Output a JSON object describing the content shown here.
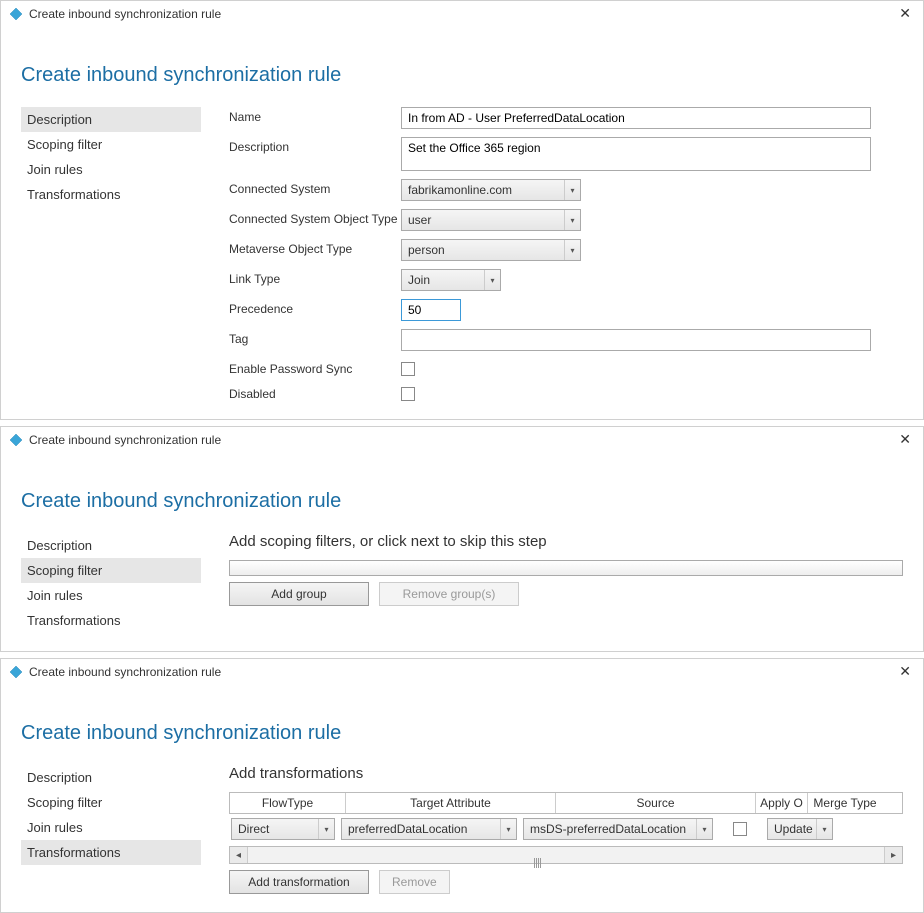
{
  "panel1": {
    "window_title": "Create inbound synchronization rule",
    "page_title": "Create inbound synchronization rule",
    "sidebar": {
      "items": [
        {
          "label": "Description"
        },
        {
          "label": "Scoping filter"
        },
        {
          "label": "Join rules"
        },
        {
          "label": "Transformations"
        }
      ]
    },
    "labels": {
      "name": "Name",
      "description": "Description",
      "connected_system": "Connected System",
      "cs_object_type": "Connected System Object Type",
      "mv_object_type": "Metaverse Object Type",
      "link_type": "Link Type",
      "precedence": "Precedence",
      "tag": "Tag",
      "enable_password_sync": "Enable Password Sync",
      "disabled": "Disabled"
    },
    "values": {
      "name": "In from AD - User PreferredDataLocation",
      "description": "Set the Office 365 region",
      "connected_system": "fabrikamonline.com",
      "cs_object_type": "user",
      "mv_object_type": "person",
      "link_type": "Join",
      "precedence": "50",
      "tag": ""
    }
  },
  "panel2": {
    "window_title": "Create inbound synchronization rule",
    "page_title": "Create inbound synchronization rule",
    "sidebar": {
      "items": [
        {
          "label": "Description"
        },
        {
          "label": "Scoping filter"
        },
        {
          "label": "Join rules"
        },
        {
          "label": "Transformations"
        }
      ]
    },
    "heading": "Add scoping filters, or click next to skip this step",
    "buttons": {
      "add_group": "Add group",
      "remove_groups": "Remove group(s)"
    }
  },
  "panel3": {
    "window_title": "Create inbound synchronization rule",
    "page_title": "Create inbound synchronization rule",
    "sidebar": {
      "items": [
        {
          "label": "Description"
        },
        {
          "label": "Scoping filter"
        },
        {
          "label": "Join rules"
        },
        {
          "label": "Transformations"
        }
      ]
    },
    "heading": "Add transformations",
    "columns": {
      "flowtype": "FlowType",
      "target": "Target Attribute",
      "source": "Source",
      "apply": "Apply O",
      "merge": "Merge Type"
    },
    "row": {
      "flowtype": "Direct",
      "target": "preferredDataLocation",
      "source": "msDS-preferredDataLocation",
      "merge": "Update"
    },
    "buttons": {
      "add_transformation": "Add transformation",
      "remove": "Remove"
    }
  }
}
